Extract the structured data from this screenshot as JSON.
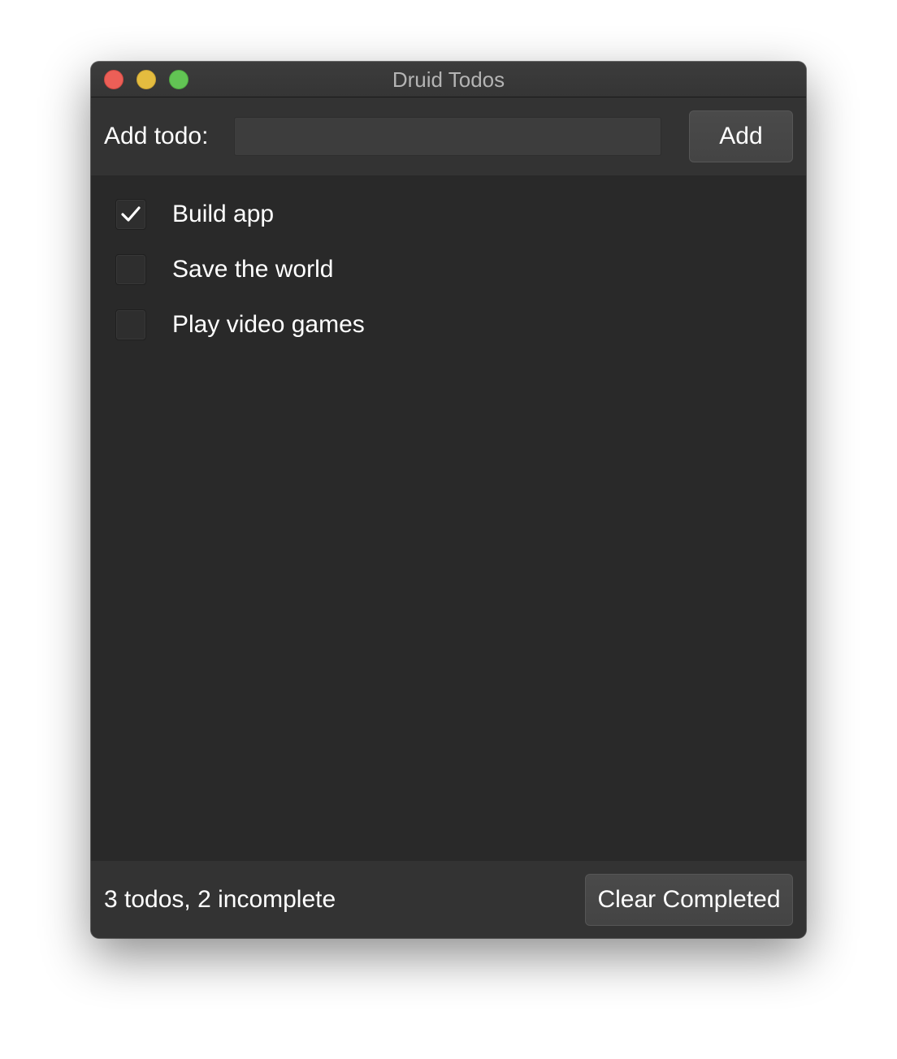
{
  "window": {
    "title": "Druid Todos",
    "traffic_lights": {
      "close_color": "#ec5f57",
      "minimize_color": "#e4bc3f",
      "maximize_color": "#62c454"
    }
  },
  "toolbar": {
    "add_label": "Add todo:",
    "input_value": "",
    "input_placeholder": "",
    "add_button_label": "Add"
  },
  "todos": [
    {
      "label": "Build app",
      "checked": true
    },
    {
      "label": "Save the world",
      "checked": false
    },
    {
      "label": "Play video games",
      "checked": false
    }
  ],
  "footer": {
    "status": "3 todos, 2 incomplete",
    "clear_button_label": "Clear Completed"
  }
}
